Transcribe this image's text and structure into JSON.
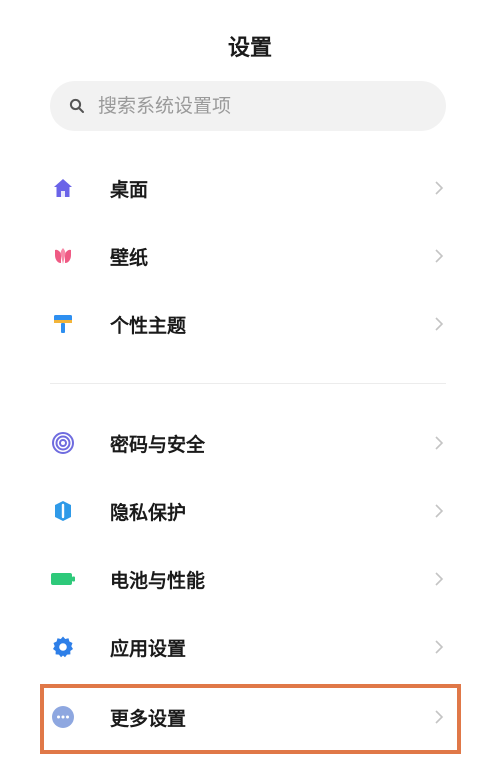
{
  "header": {
    "title": "设置"
  },
  "search": {
    "placeholder": "搜索系统设置项"
  },
  "group1": [
    {
      "label": "桌面",
      "icon": "home-icon",
      "color": "#6a63e8"
    },
    {
      "label": "壁纸",
      "icon": "tulip-icon",
      "color": "#ef5a84"
    },
    {
      "label": "个性主题",
      "icon": "paint-roller-icon",
      "color": "#2e8ff0"
    }
  ],
  "group2": [
    {
      "label": "密码与安全",
      "icon": "fingerprint-icon",
      "color": "#6f6cdf"
    },
    {
      "label": "隐私保护",
      "icon": "privacy-shield-icon",
      "color": "#2f9ae8"
    },
    {
      "label": "电池与性能",
      "icon": "battery-icon",
      "color": "#2ec97a"
    },
    {
      "label": "应用设置",
      "icon": "gear-icon",
      "color": "#2e7fe8"
    },
    {
      "label": "更多设置",
      "icon": "more-icon",
      "color": "#8ea7e0"
    }
  ],
  "highlight_color": "#e07848"
}
